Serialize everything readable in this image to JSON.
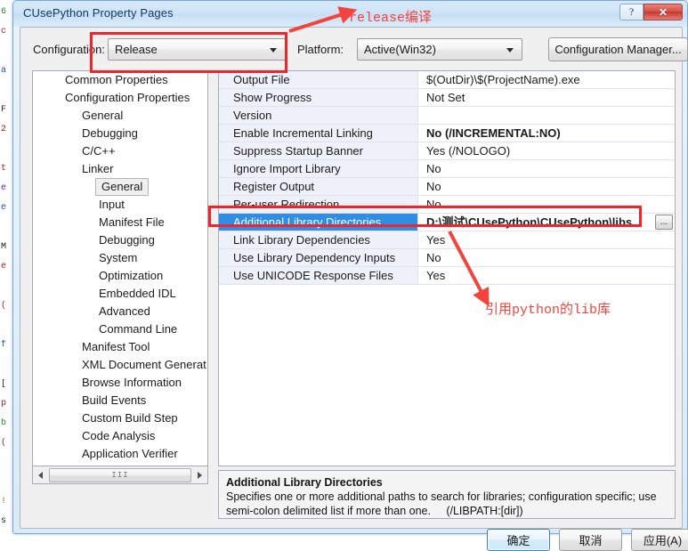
{
  "window": {
    "title": "CUsePython Property Pages",
    "help_button": "?",
    "close_button": "✕"
  },
  "config_bar": {
    "configuration_label": "Configuration:",
    "configuration_value": "Release",
    "platform_label": "Platform:",
    "platform_value": "Active(Win32)",
    "configuration_manager_button": "Configuration Manager..."
  },
  "tree": {
    "items": [
      {
        "label": "Common Properties",
        "indent": 0,
        "selected": false
      },
      {
        "label": "Configuration Properties",
        "indent": 0,
        "selected": false
      },
      {
        "label": "General",
        "indent": 1,
        "selected": false
      },
      {
        "label": "Debugging",
        "indent": 1,
        "selected": false
      },
      {
        "label": "C/C++",
        "indent": 1,
        "selected": false
      },
      {
        "label": "Linker",
        "indent": 1,
        "selected": false
      },
      {
        "label": "General",
        "indent": 2,
        "selected": true
      },
      {
        "label": "Input",
        "indent": 2,
        "selected": false
      },
      {
        "label": "Manifest File",
        "indent": 2,
        "selected": false
      },
      {
        "label": "Debugging",
        "indent": 2,
        "selected": false
      },
      {
        "label": "System",
        "indent": 2,
        "selected": false
      },
      {
        "label": "Optimization",
        "indent": 2,
        "selected": false
      },
      {
        "label": "Embedded IDL",
        "indent": 2,
        "selected": false
      },
      {
        "label": "Advanced",
        "indent": 2,
        "selected": false
      },
      {
        "label": "Command Line",
        "indent": 2,
        "selected": false
      },
      {
        "label": "Manifest Tool",
        "indent": 1,
        "selected": false
      },
      {
        "label": "XML Document Generat",
        "indent": 1,
        "selected": false
      },
      {
        "label": "Browse Information",
        "indent": 1,
        "selected": false
      },
      {
        "label": "Build Events",
        "indent": 1,
        "selected": false
      },
      {
        "label": "Custom Build Step",
        "indent": 1,
        "selected": false
      },
      {
        "label": "Code Analysis",
        "indent": 1,
        "selected": false
      },
      {
        "label": "Application Verifier",
        "indent": 1,
        "selected": false
      }
    ],
    "scrollbar": {
      "left_arrow": "◀",
      "right_arrow": "▶",
      "grip": "III"
    }
  },
  "grid": {
    "rows": [
      {
        "name": "Output File",
        "value": "$(OutDir)\\$(ProjectName).exe",
        "bold": false,
        "selected": false
      },
      {
        "name": "Show Progress",
        "value": "Not Set",
        "bold": false,
        "selected": false
      },
      {
        "name": "Version",
        "value": "",
        "bold": false,
        "selected": false
      },
      {
        "name": "Enable Incremental Linking",
        "value": "No (/INCREMENTAL:NO)",
        "bold": true,
        "selected": false
      },
      {
        "name": "Suppress Startup Banner",
        "value": "Yes (/NOLOGO)",
        "bold": false,
        "selected": false
      },
      {
        "name": "Ignore Import Library",
        "value": "No",
        "bold": false,
        "selected": false
      },
      {
        "name": "Register Output",
        "value": "No",
        "bold": false,
        "selected": false
      },
      {
        "name": "Per-user Redirection",
        "value": "No",
        "bold": false,
        "selected": false
      },
      {
        "name": "Additional Library Directories",
        "value": "D:\\测试\\CUsePython\\CUsePython\\libs",
        "bold": true,
        "selected": true
      },
      {
        "name": "Link Library Dependencies",
        "value": "Yes",
        "bold": false,
        "selected": false
      },
      {
        "name": "Use Library Dependency Inputs",
        "value": "No",
        "bold": false,
        "selected": false
      },
      {
        "name": "Use UNICODE Response Files",
        "value": "Yes",
        "bold": false,
        "selected": false
      }
    ],
    "browse_button": "..."
  },
  "description": {
    "title": "Additional Library Directories",
    "body": "Specifies one or more additional paths to search for libraries; configuration specific; use semi-colon delimited list if more than one.     (/LIBPATH:[dir])"
  },
  "buttons": {
    "ok": "确定",
    "cancel": "取消",
    "apply": "应用(A)"
  },
  "annotations": {
    "top_note": "release编译",
    "bottom_note": "引用python的lib库",
    "color": "#f4433c"
  },
  "background_editor": {
    "lines": [
      "6",
      "c",
      "",
      "a",
      "",
      "F",
      "2",
      "",
      "t",
      "e",
      "e",
      "",
      "M",
      "e",
      "",
      "(",
      "",
      "f",
      "",
      "[",
      "p",
      "b",
      "(",
      "",
      "",
      "!",
      "s"
    ]
  }
}
